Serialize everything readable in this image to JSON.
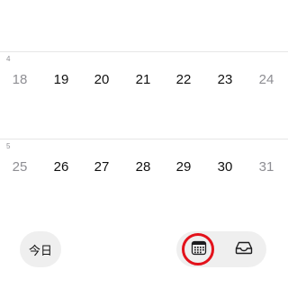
{
  "calendar": {
    "weeks": [
      {
        "week_number": "4",
        "days": [
          "18",
          "19",
          "20",
          "21",
          "22",
          "23",
          "24"
        ]
      },
      {
        "week_number": "5",
        "days": [
          "25",
          "26",
          "27",
          "28",
          "29",
          "30",
          "31"
        ]
      }
    ]
  },
  "toolbar": {
    "today_label": "今日",
    "calendar_icon": "calendar-icon",
    "inbox_icon": "inbox-icon",
    "selected": "calendar"
  },
  "colors": {
    "weekday_text": "#111111",
    "weekend_text": "#8e8e93",
    "button_bg": "#efefef",
    "highlight_ring": "#e3121b"
  }
}
